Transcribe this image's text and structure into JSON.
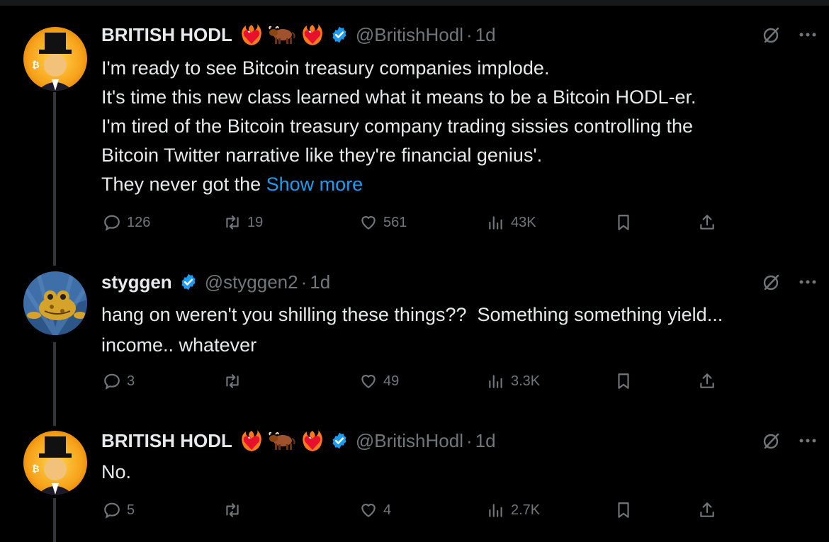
{
  "tweets": [
    {
      "name": "BRITISH HODL",
      "emojis": [
        "heart-on-fire",
        "ox",
        "heart-on-fire"
      ],
      "handle": "@BritishHodl",
      "dot": "·",
      "time": "1d",
      "lines": [
        "I'm ready to see Bitcoin treasury companies implode.",
        "It's time this new class learned what it means to be a Bitcoin HODL-er.",
        "I'm tired of the Bitcoin treasury company trading sissies controlling the",
        "Bitcoin Twitter narrative like they're financial genius'."
      ],
      "last_line": "They never got the ",
      "show_more": "Show more",
      "replies": "126",
      "reposts": "19",
      "likes": "561",
      "views": "43K"
    },
    {
      "name": "styggen",
      "handle": "@styggen2",
      "dot": "·",
      "time": "1d",
      "lines": [
        "hang on weren't you shilling these things??  Something something yield...",
        "income.. whatever"
      ],
      "replies": "3",
      "reposts": "",
      "likes": "49",
      "views": "3.3K"
    },
    {
      "name": "BRITISH HODL",
      "emojis": [
        "heart-on-fire",
        "ox",
        "heart-on-fire"
      ],
      "handle": "@BritishHodl",
      "dot": "·",
      "time": "1d",
      "lines": [
        "No."
      ],
      "replies": "5",
      "reposts": "",
      "likes": "4",
      "views": "2.7K"
    }
  ],
  "colors": {
    "background": "#000000",
    "text": "#e7e9ea",
    "muted": "#71767b",
    "link": "#1d9bf0",
    "verified": "#1d9bf0",
    "thread_line": "#333639"
  }
}
